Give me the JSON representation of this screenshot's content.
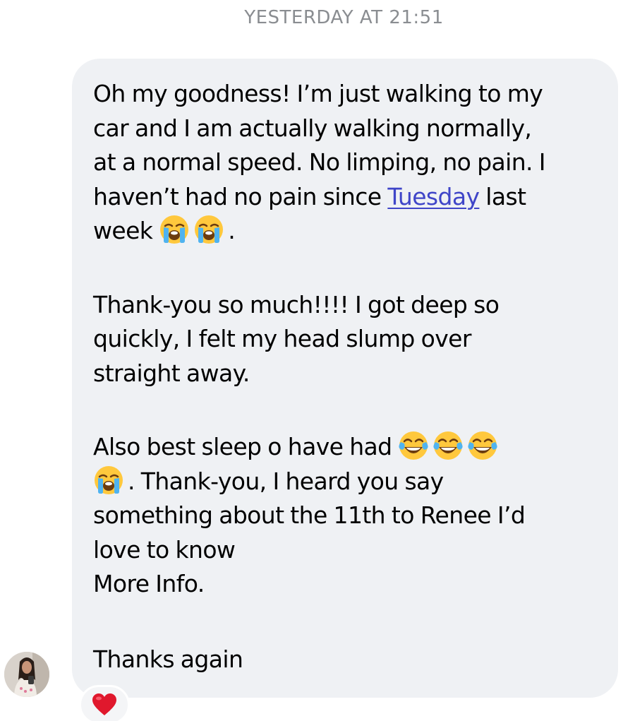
{
  "header": {
    "timestamp": "YESTERDAY AT 21:51"
  },
  "message": {
    "paragraph1": {
      "line1": "Oh my goodness! I’m just walking to my",
      "line2": "car and I am actually walking normally,",
      "line3": "at a normal speed. No limping, no pain. I",
      "line4_before": "haven’t had no pain since ",
      "line4_link": "Tuesday",
      "line4_after": " last",
      "line5_text": "week ",
      "line5_end": "."
    },
    "paragraph2": {
      "line1": "Thank-you so much!!!! I got deep so",
      "line2": "quickly, I felt my head slump over",
      "line3": "straight away."
    },
    "paragraph3": {
      "line1": "Also best sleep o have had ",
      "line2_after": ". Thank-you, I heard you say",
      "line3": "something about the 11th to Renee I’d",
      "line4": "love to know",
      "line5": "More Info."
    },
    "paragraph4": {
      "line1": "Thanks again"
    },
    "link_color": "#3f45c8"
  },
  "emojis": {
    "crying": "loudly-crying-face",
    "laughing": "face-with-tears-of-joy"
  },
  "reaction": {
    "icon": "red-heart"
  },
  "colors": {
    "bubble_background": "#eff1f4",
    "timestamp": "#8a8d91",
    "heart": "#e0182d"
  }
}
